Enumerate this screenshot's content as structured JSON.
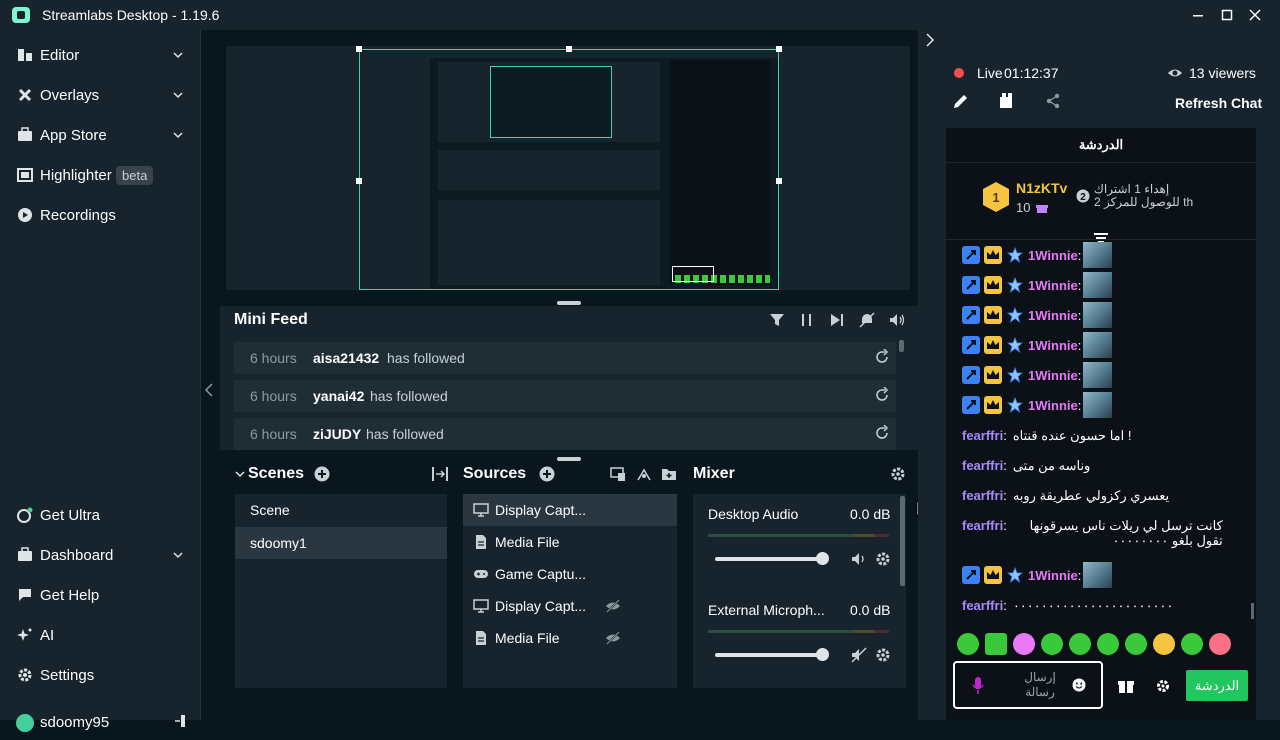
{
  "window": {
    "title": "Streamlabs Desktop - 1.19.6"
  },
  "sidebar": {
    "items": [
      {
        "label": "Editor",
        "icon": "editor-icon",
        "has_chevron": true
      },
      {
        "label": "Overlays",
        "icon": "overlays-icon",
        "has_chevron": true
      },
      {
        "label": "App Store",
        "icon": "app-store-icon",
        "has_chevron": true
      },
      {
        "label": "Highlighter",
        "icon": "highlighter-icon",
        "badge": "beta"
      },
      {
        "label": "Recordings",
        "icon": "recordings-icon"
      }
    ],
    "bottom_items": [
      {
        "label": "Get Ultra",
        "icon": "ultra-icon"
      },
      {
        "label": "Dashboard",
        "icon": "dashboard-icon",
        "has_chevron": true
      },
      {
        "label": "Get Help",
        "icon": "help-icon"
      },
      {
        "label": "AI",
        "icon": "ai-icon"
      },
      {
        "label": "Settings",
        "icon": "settings-icon"
      }
    ],
    "user": "sdoomy95"
  },
  "mini_feed": {
    "title": "Mini Feed",
    "rows": [
      {
        "time": "6 hours",
        "user": "aisa21432",
        "action": "has followed"
      },
      {
        "time": "6 hours",
        "user": "yanai42",
        "action": "has followed"
      },
      {
        "time": "6 hours",
        "user": "ziJUDY",
        "action": "has followed"
      }
    ]
  },
  "scenes": {
    "title": "Scenes",
    "items": [
      "Scene",
      "sdoomy1"
    ],
    "selected": 1
  },
  "sources": {
    "title": "Sources",
    "items": [
      {
        "name": "Display Capt...",
        "icon": "monitor-icon",
        "hidden": false
      },
      {
        "name": "Media File",
        "icon": "file-icon",
        "hidden": false
      },
      {
        "name": "Game Captu...",
        "icon": "gamepad-icon",
        "hidden": false
      },
      {
        "name": "Display Capt...",
        "icon": "monitor-icon",
        "hidden": true
      },
      {
        "name": "Media File",
        "icon": "file-icon",
        "hidden": true
      }
    ]
  },
  "mixer": {
    "title": "Mixer",
    "channels": [
      {
        "name": "Desktop Audio",
        "db": "0.0 dB",
        "muted": false
      },
      {
        "name": "External Microph...",
        "db": "0.0 dB",
        "muted": true
      }
    ]
  },
  "stream": {
    "live_label": "Live",
    "duration": "01:12:37",
    "viewers": "13 viewers",
    "refresh_chat": "Refresh Chat"
  },
  "chat": {
    "header": "الدردشة",
    "gift": {
      "user": "N1zKTv",
      "count": "10",
      "text": "إهداء 1 اشتراك للوصول للمركز 2 th",
      "rank": "2"
    },
    "messages": [
      {
        "user": "1Winnie",
        "text": "",
        "type": "badges"
      },
      {
        "user": "1Winnie",
        "text": "",
        "type": "badges"
      },
      {
        "user": "1Winnie",
        "text": "",
        "type": "badges"
      },
      {
        "user": "1Winnie",
        "text": "",
        "type": "badges"
      },
      {
        "user": "1Winnie",
        "text": "",
        "type": "badges"
      },
      {
        "user": "1Winnie",
        "text": "",
        "type": "badges"
      },
      {
        "user": "fearffri",
        "text": "! اما حسون عنده قنتاه",
        "type": "plain"
      },
      {
        "user": "fearffri",
        "text": "وناسه من متى",
        "type": "plain"
      },
      {
        "user": "fearffri",
        "text": "يعسري ركزولي عطريقة روبه",
        "type": "plain"
      },
      {
        "user": "fearffri",
        "text": "كانت ترسل لي ريلات ناس يسرقونها تقول بلغو ٠٠٠٠٠٠٠٠",
        "type": "plain"
      },
      {
        "user": "1Winnie",
        "text": "",
        "type": "badges"
      },
      {
        "user": "fearffri",
        "text": "٠٠٠٠٠٠٠٠٠٠٠٠٠٠٠٠٠٠٠٠٠٠٠",
        "type": "plain"
      }
    ],
    "input_placeholder": "إرسال رسالة",
    "send_label": "الدردشة"
  },
  "colors": {
    "accent": "#80f5d2",
    "bg": "#09161d",
    "panel": "#17242d",
    "live": "#f84d4d",
    "send": "#22c55e"
  }
}
